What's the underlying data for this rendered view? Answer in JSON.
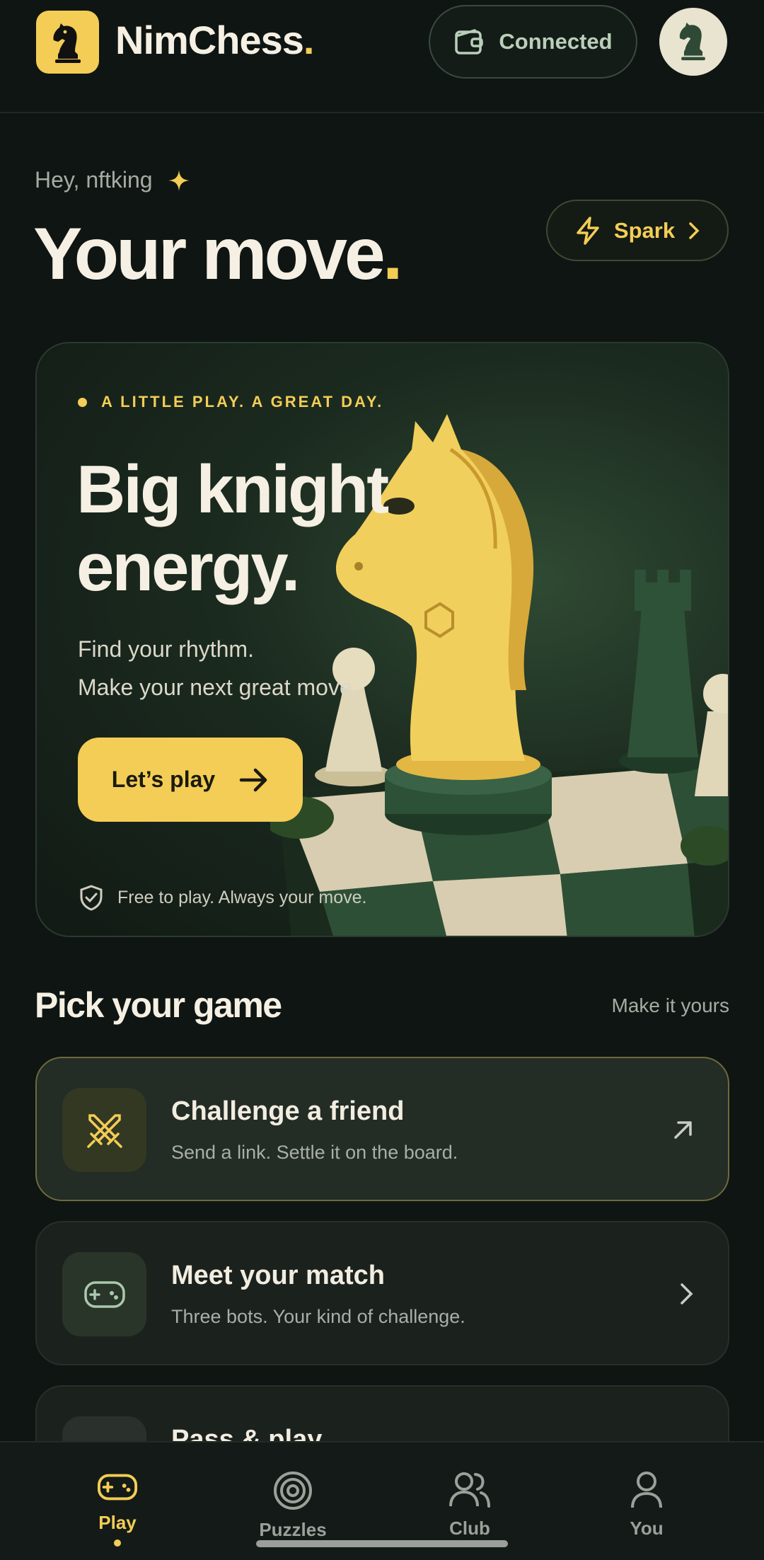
{
  "header": {
    "brand": "NimChess",
    "brand_dot": ".",
    "wallet_status": "Connected"
  },
  "greeting": {
    "text": "Hey, nftking",
    "title": "Your move",
    "title_dot": ".",
    "spark_label": "Spark"
  },
  "hero": {
    "eyebrow": "A LITTLE PLAY. A GREAT DAY.",
    "title_line1": "Big knight",
    "title_line2": "energy.",
    "sub_line1": "Find your rhythm.",
    "sub_line2": "Make your next great move.",
    "cta_label": "Let’s play",
    "footnote": "Free to play. Always your move."
  },
  "games": {
    "title": "Pick your game",
    "link": "Make it yours",
    "items": [
      {
        "title": "Challenge a friend",
        "subtitle": "Send a link. Settle it on the board.",
        "icon": "swords-icon"
      },
      {
        "title": "Meet your match",
        "subtitle": "Three bots. Your kind of challenge.",
        "icon": "gamepad-icon"
      },
      {
        "title": "Pass & play",
        "subtitle": "",
        "icon": "pass-play-icon"
      }
    ]
  },
  "nav": {
    "items": [
      {
        "label": "Play",
        "icon": "gamepad-icon"
      },
      {
        "label": "Puzzles",
        "icon": "target-icon"
      },
      {
        "label": "Club",
        "icon": "users-icon"
      },
      {
        "label": "You",
        "icon": "user-icon"
      }
    ],
    "active": "Play"
  },
  "colors": {
    "accent": "#f3cd55",
    "background": "#0f1512",
    "card": "#1b221e"
  }
}
